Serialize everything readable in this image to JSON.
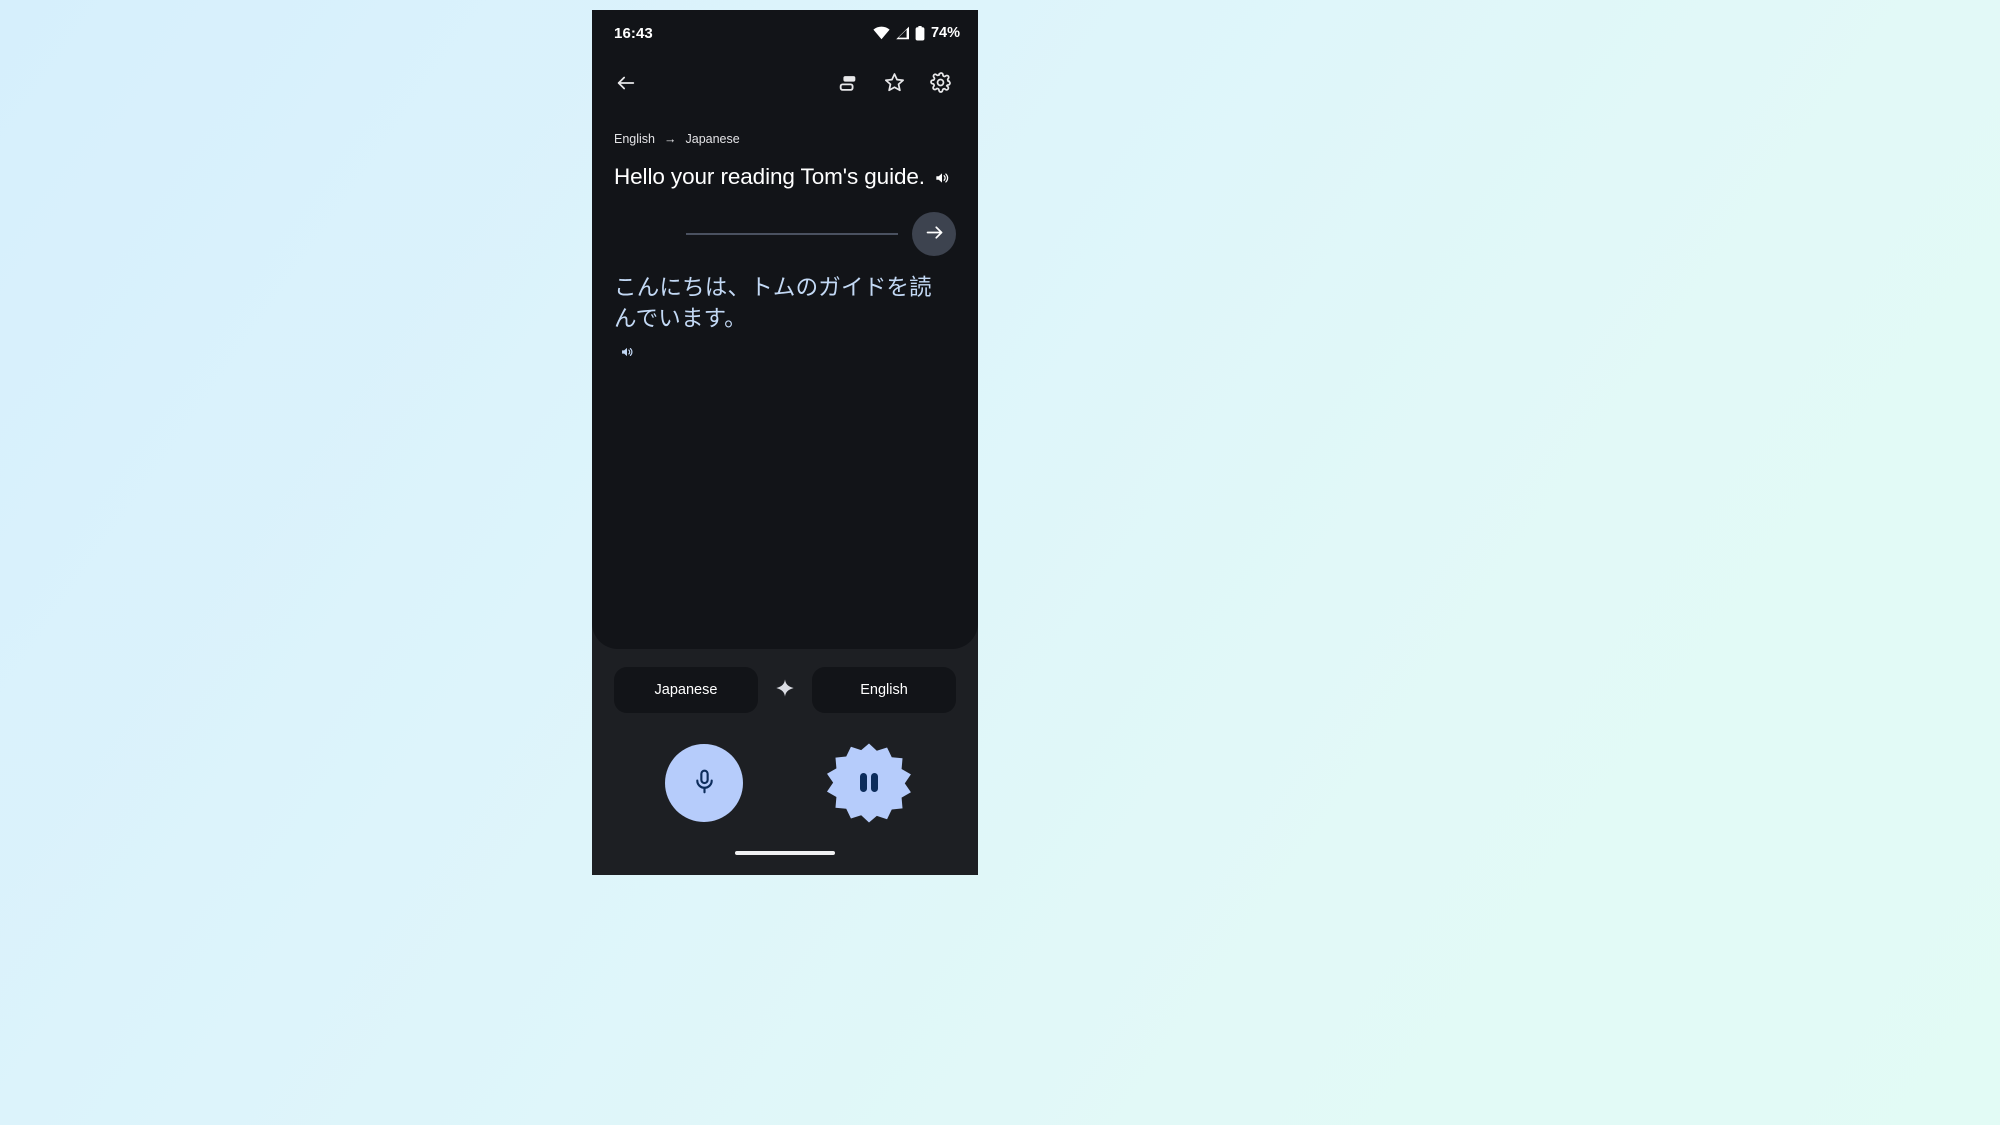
{
  "statusbar": {
    "clock": "16:43",
    "battery_percent": "74%",
    "icons": [
      "wifi-icon",
      "cellular-signal-icon",
      "battery-icon"
    ]
  },
  "toolbar": {
    "back_icon": "back-arrow-icon",
    "transcribe_icon": "transcribe-icon",
    "favorite_icon": "star-icon",
    "settings_icon": "gear-icon"
  },
  "translation": {
    "source_language": "English",
    "direction_arrow": "→",
    "target_language": "Japanese",
    "source_text": "Hello your reading Tom's guide.",
    "target_text": "こんにちは、トムのガイドを読んでいます。",
    "source_speaker_icon": "speaker-icon",
    "target_speaker_icon": "speaker-icon",
    "submit_icon": "arrow-right-icon",
    "target_text_color": "#c3d9f5"
  },
  "bottom": {
    "left_chip": "Japanese",
    "sparkle_icon": "sparkle-icon",
    "right_chip": "English",
    "mic_icon": "microphone-icon",
    "pause_icon": "pause-icon",
    "accent_color": "#b6ccfb",
    "icon_color": "#0d2d5c"
  },
  "navbar": {
    "home_indicator": "home-indicator"
  }
}
